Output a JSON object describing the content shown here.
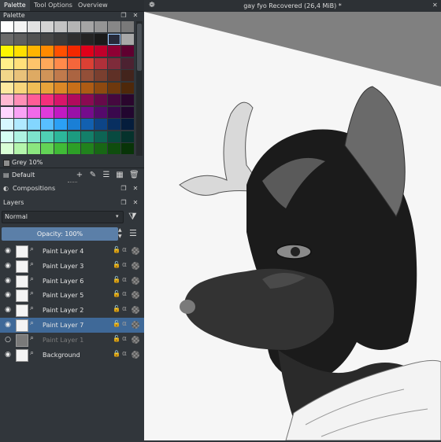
{
  "tabs": [
    {
      "label": "Palette"
    },
    {
      "label": "Tool Options"
    },
    {
      "label": "Overview"
    }
  ],
  "palette": {
    "title": "Palette",
    "current_color_name": "Grey 10%",
    "palette_name": "Default",
    "swatch_rows": [
      [
        "#ffffff",
        "#f3f3f3",
        "#e2e2e2",
        "#d3d3d3",
        "#c3c3c3",
        "#b4b4b4",
        "#a5a5a5",
        "#959595",
        "#878787",
        "#797979"
      ],
      [
        "#6b6b6b",
        "#5f5f5f",
        "#525252",
        "#464646",
        "#3b3b3b",
        "#2f2f2f",
        "#242424",
        "#1a1a1a",
        "#262a3a",
        "#a8a8a8"
      ],
      [
        "#fdf600",
        "#ffdf00",
        "#ffb400",
        "#ff8a00",
        "#ff5000",
        "#f22800",
        "#e0001a",
        "#c0002b",
        "#8e0034",
        "#5f0030"
      ],
      [
        "#fff08a",
        "#ffe07a",
        "#ffc46b",
        "#ffa85a",
        "#ff8a4b",
        "#f4663b",
        "#db4034",
        "#b0303a",
        "#7e2b3a",
        "#4c2231"
      ],
      [
        "#f2d68a",
        "#e9c27a",
        "#deaa63",
        "#d09458",
        "#c07a4c",
        "#ab6441",
        "#934f38",
        "#7a3f2f",
        "#5f3026",
        "#43241c"
      ],
      [
        "#fde9a0",
        "#f8d67c",
        "#f0bd56",
        "#e7a33a",
        "#dc8826",
        "#c86f19",
        "#ad5b14",
        "#8e4910",
        "#6e380d",
        "#4e280a"
      ],
      [
        "#ffb9d2",
        "#ff8fb6",
        "#ff5c97",
        "#f42f7b",
        "#d8156a",
        "#b10a5d",
        "#8a0a52",
        "#66094a",
        "#45083f",
        "#2a062d"
      ],
      [
        "#ffd6ff",
        "#f9a3f5",
        "#f06ae9",
        "#e03bdb",
        "#c21ac2",
        "#9a10a8",
        "#750c8c",
        "#550a6c",
        "#3a084d",
        "#22062f"
      ],
      [
        "#d7f7ff",
        "#b0e9ff",
        "#83d6ff",
        "#58bfff",
        "#2ba0f5",
        "#1a7fd6",
        "#1260b0",
        "#0d4587",
        "#082f60",
        "#051d3c"
      ],
      [
        "#d6fff4",
        "#aef3e2",
        "#7de3cc",
        "#4fd0b4",
        "#2cb79a",
        "#1c9b80",
        "#137f69",
        "#0d6454",
        "#084a40",
        "#05322c"
      ],
      [
        "#d9ffd6",
        "#b4f5ac",
        "#8be67f",
        "#63d356",
        "#40bb37",
        "#2d9f27",
        "#21821d",
        "#186715",
        "#0f4d0e",
        "#083408"
      ]
    ]
  },
  "compositions": {
    "title": "Compositions"
  },
  "layers": {
    "title": "Layers",
    "blend_mode": "Normal",
    "opacity_label": "Opacity:  100%",
    "items": [
      {
        "name": "Paint Layer 4",
        "selected": false,
        "visible": true
      },
      {
        "name": "Paint Layer 3",
        "selected": false,
        "visible": true
      },
      {
        "name": "Paint Layer 6",
        "selected": false,
        "visible": true
      },
      {
        "name": "Paint Layer 5",
        "selected": false,
        "visible": true
      },
      {
        "name": "Paint Layer 2",
        "selected": false,
        "visible": true
      },
      {
        "name": "Paint Layer 7",
        "selected": true,
        "visible": true
      },
      {
        "name": "Paint Layer 1",
        "selected": false,
        "visible": false
      },
      {
        "name": "Background",
        "selected": false,
        "visible": true,
        "locked": true
      }
    ]
  },
  "document": {
    "title": "gay fyo Recovered  (26,4 MiB)  *"
  },
  "colors": {
    "accent": "#3f6998",
    "opacity_bar": "#5b7fa8",
    "panel_bg": "#31363b"
  }
}
